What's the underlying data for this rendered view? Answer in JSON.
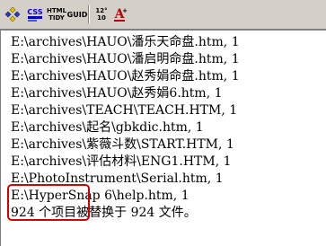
{
  "toolbar": {
    "buttons": [
      {
        "name": "diamonds-icon"
      },
      {
        "name": "css-button",
        "label": "CSS"
      },
      {
        "name": "html-tidy-button",
        "label_top": "HTML",
        "label_bottom": "TIDY"
      },
      {
        "name": "guid-button",
        "label": "GUID"
      },
      {
        "name": "number-convert-button",
        "label_top": "12°",
        "label_bottom": "10"
      },
      {
        "name": "font-color-button",
        "label": "A"
      }
    ],
    "colors": {
      "diamond_blue": "#2040c0",
      "diamond_yellow": "#e8c000",
      "css_blue": "#0000cc",
      "font_a_red": "#c00000"
    }
  },
  "results": {
    "lines": [
      "E:\\archives\\HAUO\\潘乐天命盘.htm, 1",
      "E:\\archives\\HAUO\\潘启明命盘.htm, 1",
      "E:\\archives\\HAUO\\赵秀娟命盘.htm, 1",
      "E:\\archives\\HAUO\\赵秀娟6.htm, 1",
      "E:\\archives\\TEACH\\TEACH.HTM, 1",
      "E:\\archives\\起名\\gbkdic.htm, 1",
      "E:\\archives\\紫薇斗数\\START.HTM, 1",
      "E:\\archives\\评估材料\\ENG1.HTM, 1",
      "E:\\PhotoInstrument\\Serial.htm, 1",
      "E:\\HyperSnap 6\\help.htm, 1",
      "924 个项目被替换于 924 文件。"
    ]
  },
  "annotation": {
    "color": "#d00000"
  }
}
